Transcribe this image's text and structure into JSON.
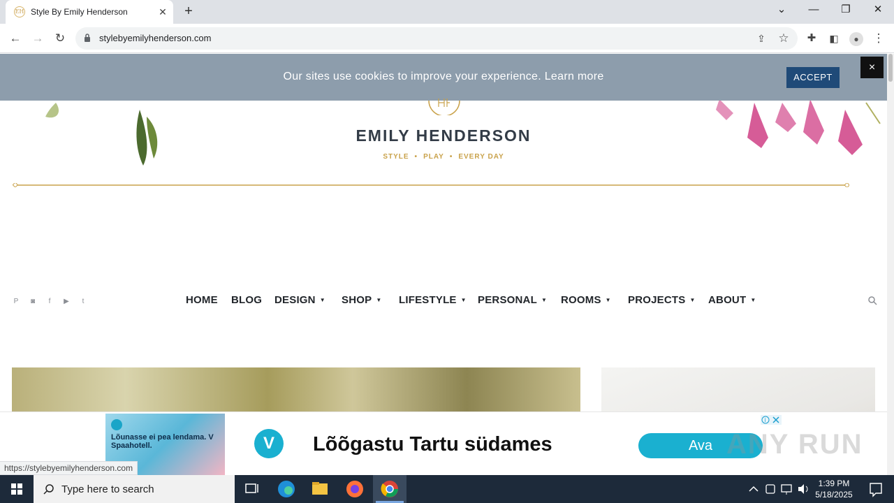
{
  "browser": {
    "tab_title": "Style By Emily Henderson",
    "url": "stylebyemilyhenderson.com",
    "status_url": "https://stylebyemilyhenderson.com"
  },
  "cookie_banner": {
    "message": "Our sites use cookies to improve your experience. Learn more",
    "accept_label": "ACCEPT",
    "close_label": "×"
  },
  "header": {
    "logo_text": "EMILY HENDERSON",
    "tagline": [
      "STYLE",
      "PLAY",
      "EVERY DAY"
    ]
  },
  "nav": {
    "items": [
      {
        "label": "HOME",
        "dropdown": false
      },
      {
        "label": "BLOG",
        "dropdown": false
      },
      {
        "label": "DESIGN",
        "dropdown": true
      },
      {
        "label": "SHOP",
        "dropdown": true
      },
      {
        "label": "LIFESTYLE",
        "dropdown": true
      },
      {
        "label": "PERSONAL",
        "dropdown": true
      },
      {
        "label": "ROOMS",
        "dropdown": true
      },
      {
        "label": "PROJECTS",
        "dropdown": true
      },
      {
        "label": "ABOUT",
        "dropdown": true
      }
    ],
    "social_icons": [
      "pinterest-icon",
      "instagram-icon",
      "facebook-icon",
      "youtube-icon",
      "twitter-icon"
    ]
  },
  "ad": {
    "image_text": "Lõunasse ei pea lendama. V Spaahotell.",
    "headline": "Lõõgastu Tartu südames",
    "button_label": "Ava",
    "watermark": "ANY RUN"
  },
  "taskbar": {
    "search_placeholder": "Type here to search",
    "time": "1:39 PM",
    "date": "5/18/2025"
  },
  "colors": {
    "cookie_bg": "#8d9dac",
    "accept_bg": "#1f4a78",
    "gold": "#c9a24b",
    "ad_accent": "#1ab0d0"
  }
}
